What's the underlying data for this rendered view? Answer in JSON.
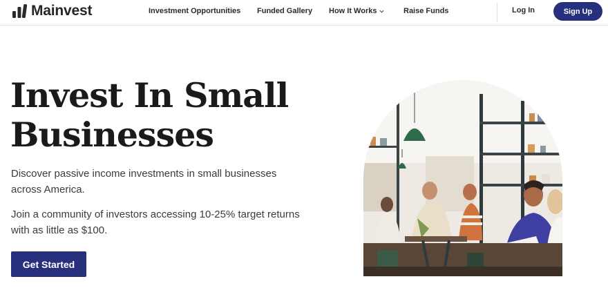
{
  "header": {
    "brand": "Mainvest",
    "nav": [
      {
        "label": "Investment Opportunities"
      },
      {
        "label": "Funded Gallery"
      },
      {
        "label": "How It Works",
        "icon": "chevron-down-icon"
      },
      {
        "label": "Raise Funds"
      }
    ],
    "login_label": "Log In",
    "signup_label": "Sign Up"
  },
  "hero": {
    "headline_line1": "Invest In Small",
    "headline_line2": "Businesses",
    "paragraph1": "Discover passive income investments in small businesses across America.",
    "paragraph2": "Join a community of investors accessing 10-25% target returns with as little as $100.",
    "cta_label": "Get Started"
  },
  "colors": {
    "brand_navy": "#27307d",
    "text_dark": "#1a1a1a",
    "text_body": "#3b3b3b"
  }
}
